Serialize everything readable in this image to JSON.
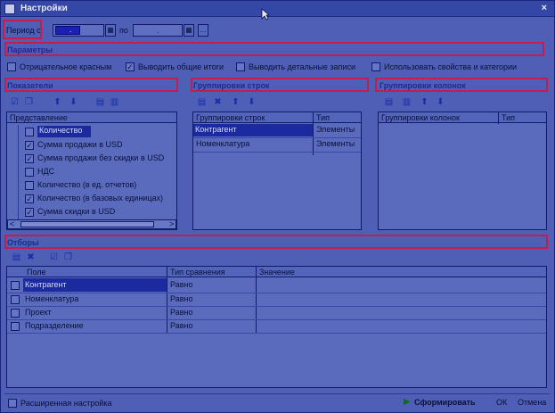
{
  "window": {
    "title": "Настройки",
    "close_glyph": "×"
  },
  "period": {
    "label": "Период с:",
    "from": ".",
    "to_label": "по",
    "to": ".",
    "more": "..."
  },
  "params": {
    "header": "Параметры",
    "checks": [
      {
        "label": "Отрицательное красным",
        "checked": false
      },
      {
        "label": "Выводить общие итоги",
        "checked": true
      },
      {
        "label": "Выводить детальные записи",
        "checked": false
      },
      {
        "label": "Использовать свойства и категории",
        "checked": false
      }
    ]
  },
  "indicators": {
    "header": "Показатели",
    "column": "Представление",
    "items": [
      {
        "label": "Количество",
        "checked": false,
        "selected": true
      },
      {
        "label": "Сумма продажи в USD",
        "checked": true
      },
      {
        "label": "Сумма продажи без скидки в USD",
        "checked": true
      },
      {
        "label": "НДС",
        "checked": false
      },
      {
        "label": "Количество (в ед. отчетов)",
        "checked": false
      },
      {
        "label": "Количество (в базовых единицах)",
        "checked": true
      },
      {
        "label": "Сумма скидки в USD",
        "checked": true
      }
    ],
    "scroll_left": "<",
    "scroll_right": ">"
  },
  "row_groups": {
    "header": "Группировки строк",
    "columns": [
      "Группировки строк",
      "Тип"
    ],
    "rows": [
      {
        "name": "Контрагент",
        "type": "Элементы",
        "selected": true
      },
      {
        "name": "Номенклатура",
        "type": "Элементы"
      }
    ]
  },
  "col_groups": {
    "header": "Группировки колонок",
    "columns": [
      "Группировки колонок",
      "Тип"
    ]
  },
  "filters": {
    "header": "Отборы",
    "columns": [
      "Поле",
      "Тип сравнения",
      "Значение"
    ],
    "rows": [
      {
        "field": "Контрагент",
        "compare": "Равно",
        "value": "",
        "selected": true
      },
      {
        "field": "Номенклатура",
        "compare": "Равно",
        "value": ""
      },
      {
        "field": "Проект",
        "compare": "Равно",
        "value": ""
      },
      {
        "field": "Подразделение",
        "compare": "Равно",
        "value": ""
      }
    ]
  },
  "footer": {
    "extended_label": "Расширенная настройка",
    "generate": "Сформировать",
    "ok": "ОК",
    "cancel": "Отмена"
  },
  "colors": {
    "highlight": "#c21c50"
  }
}
